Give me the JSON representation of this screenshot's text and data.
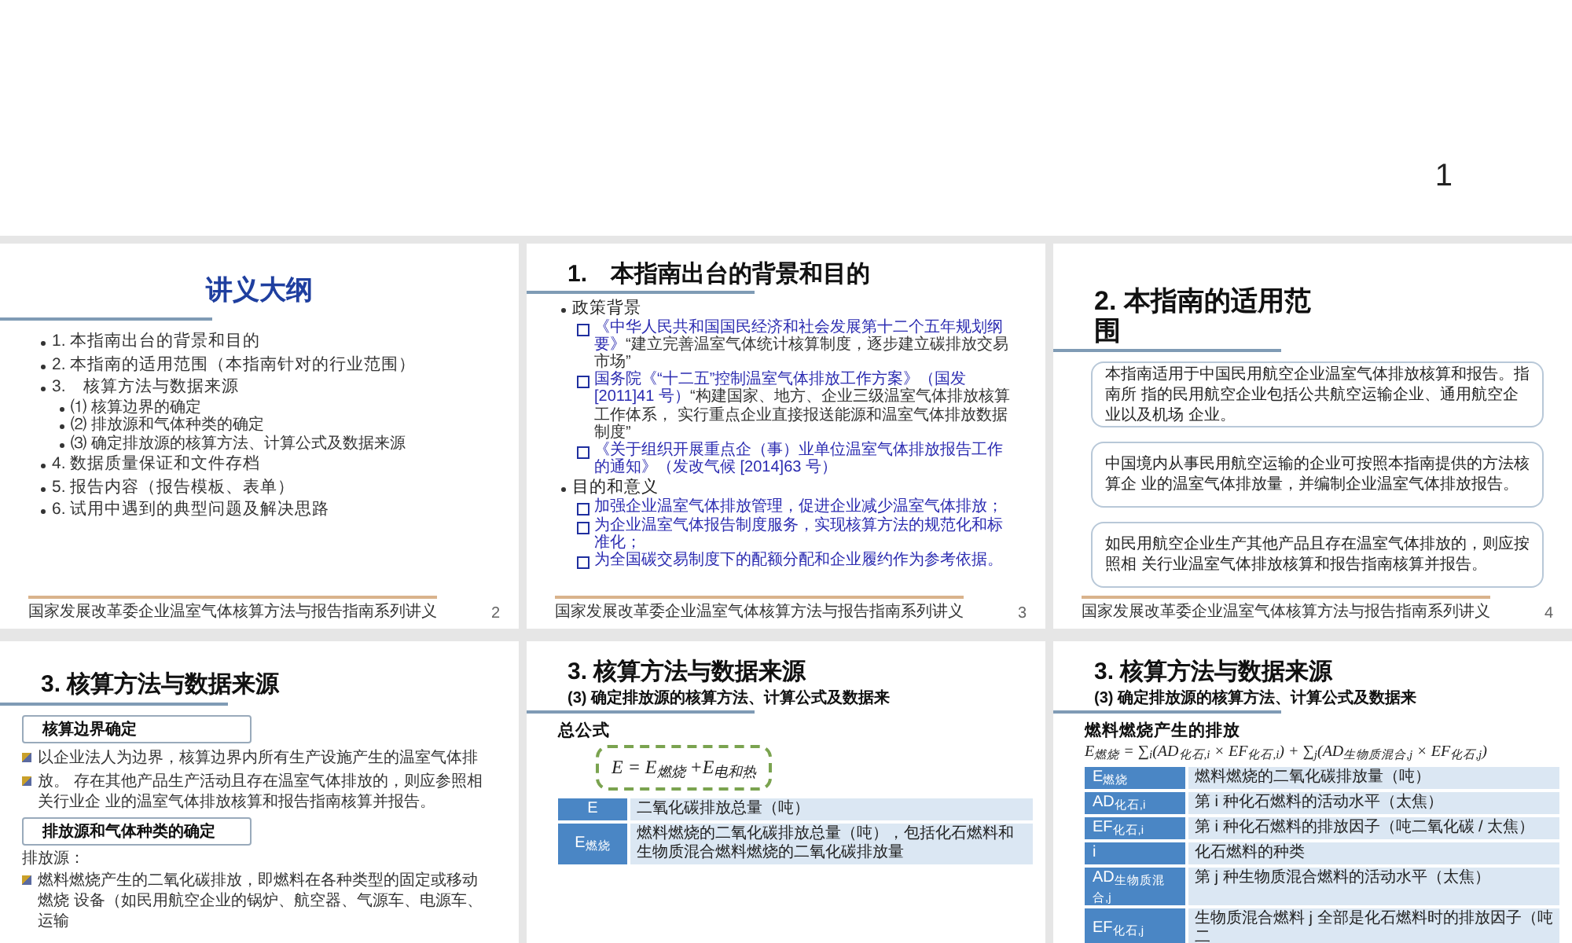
{
  "top_slide": {
    "page_number": "1"
  },
  "slides": [
    {
      "kind": "outline",
      "title": "讲义大纲",
      "items": [
        {
          "text": "1. 本指南出台的背景和目的"
        },
        {
          "text": "2. 本指南的适用范围（本指南针对的行业范围）"
        },
        {
          "text": "3.　核算方法与数据来源",
          "children": [
            {
              "text": "⑴ 核算边界的确定"
            },
            {
              "text": "⑵ 排放源和气体种类的确定"
            },
            {
              "text": "⑶ 确定排放源的核算方法、计算公式及数据来源"
            }
          ]
        },
        {
          "text": "4. 数据质量保证和文件存档"
        },
        {
          "text": "5. 报告内容（报告模板、表单）"
        },
        {
          "text": "6. 试用中遇到的典型问题及解决思路"
        }
      ],
      "footer": "国家发展改革委企业温室气体核算方法与报告指南系列讲义",
      "page_number": "2"
    },
    {
      "kind": "sections",
      "title": "1.　本指南出台的背景和目的",
      "sections": [
        {
          "heading": "政策背景",
          "items": [
            {
              "source": "《中华人民共和国国民经济和社会发展第十二个五年规划纲要》",
              "quote": "“建立完善温室气体统计核算制度，逐步建立碳排放交易市场”"
            },
            {
              "source": "国务院《“十二五”控制温室气体排放工作方案》（国发[2011]41 号）",
              "quote": "“构建国家、地方、企业三级温室气体排放核算工作体系， 实行重点企业直接报送能源和温室气体排放数据制度”"
            },
            {
              "source": "《关于组织开展重点企（事）业单位温室气体排放报告工作的通知》（发改气候 [2014]63 号）"
            }
          ]
        },
        {
          "heading": "目的和意义",
          "items": [
            {
              "source": "加强企业温室气体排放管理，促进企业减少温室气体排放；"
            },
            {
              "source": "为企业温室气体报告制度服务，实现核算方法的规范化和标准化；"
            },
            {
              "source": "为全国碳交易制度下的配额分配和企业履约作为参考依据。"
            }
          ]
        }
      ],
      "footer": "国家发展改革委企业温室气体核算方法与报告指南系列讲义",
      "page_number": "3"
    },
    {
      "kind": "boxes",
      "title": "2. 本指南的适用范围",
      "boxes": [
        "本指南适用于中国民用航空企业温室气体排放核算和报告。指南所 指的民用航空企业包括公共航空运输企业、通用航空企业以及机场 企业。",
        "中国境内从事民用航空运输的企业可按照本指南提供的方法核算企 业的温室气体排放量，并编制企业温室气体排放报告。",
        "如民用航空企业生产其他产品且存在温室气体排放的，则应按照相 关行业温室气体排放核算和报告指南核算并报告。"
      ],
      "footer": "国家发展改革委企业温室气体核算方法与报告指南系列讲义",
      "page_number": "4"
    },
    {
      "kind": "blocks",
      "title": "3. 核算方法与数据来源",
      "blocks": [
        {
          "kind": "heading",
          "text": "核算边界确定"
        },
        {
          "kind": "bullet",
          "text": "以企业法人为边界，核算边界内所有生产设施产生的温室气体排"
        },
        {
          "kind": "bullet",
          "text": "放。 存在其他产品生产活动且存在温室气体排放的，则应参照相关行业企 业的温室气体排放核算和报告指南核算并报告。"
        },
        {
          "kind": "heading",
          "text": "排放源和气体种类的确定"
        },
        {
          "kind": "plain",
          "text": "排放源："
        },
        {
          "kind": "bullet",
          "text": "燃料燃烧产生的二氧化碳排放，即燃料在各种类型的固定或移动燃烧 设备（如民用航空企业的锅炉、航空器、气源车、电源车、运输"
        }
      ]
    },
    {
      "kind": "formula",
      "title": "3. 核算方法与数据来源",
      "subtitle": "(3) 确定排放源的核算方法、计算公式及数据来",
      "label": "总公式",
      "formula": "E = E$_{燃烧}$ +E$_{电和热}$",
      "rows": [
        {
          "term": "E",
          "meaning": "二氧化碳排放总量（吨）"
        },
        {
          "term": "E$_{燃烧}$",
          "meaning": "燃料燃烧的二氧化碳排放总量（吨），包括化石燃料和生物质混合燃料燃烧的二氧化碳排放量"
        }
      ]
    },
    {
      "kind": "formula",
      "title": "3. 核算方法与数据来源",
      "subtitle": "(3) 确定排放源的核算方法、计算公式及数据来",
      "label": "燃料燃烧产生的排放",
      "formula": "E$_{燃烧}$ = ∑$_{i}$(AD$_{化石,i}$ × EF$_{化石,i}$) + ∑$_{j}$(AD$_{生物质混合,j}$ × EF$_{化石,j}$)",
      "rows": [
        {
          "term": "E$_{燃烧}$",
          "meaning": "燃料燃烧的二氧化碳排放量（吨）"
        },
        {
          "term": "AD$_{化石,i}$",
          "meaning": "第 i 种化石燃料的活动水平（太焦）"
        },
        {
          "term": "EF$_{化石,i}$",
          "meaning": "第 i 种化石燃料的排放因子（吨二氧化碳 / 太焦）"
        },
        {
          "term": "i",
          "meaning": "化石燃料的种类"
        },
        {
          "term": "AD$_{生物质混合,j}$",
          "meaning": "第 j 种生物质混合燃料的活动水平（太焦）"
        },
        {
          "term": "EF$_{化石,j}$",
          "meaning": "生物质混合燃料 j 全部是化石燃料时的排放因子（吨二"
        }
      ]
    }
  ]
}
